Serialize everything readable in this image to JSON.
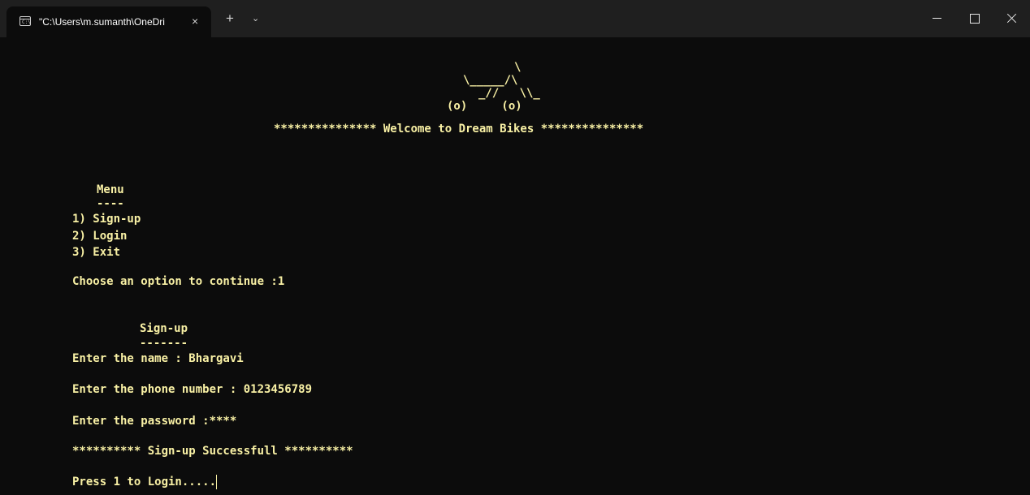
{
  "window": {
    "tab_title": "\"C:\\Users\\m.sumanth\\OneDri",
    "tab_icon_text": "C:\\",
    "tab_close": "×",
    "new_tab": "+",
    "dropdown": "⌄",
    "icons": {
      "tab": "terminal-icon",
      "minimize": "minimize-icon",
      "maximize": "maximize-icon",
      "close": "close-icon"
    }
  },
  "terminal": {
    "colors": {
      "background": "#0c0c0c",
      "text": "#f9f1a5"
    },
    "art": {
      "line1": "\\",
      "line2": "\\_____/\\",
      "line3": "_//   \\\\_",
      "line4": "(o)     (o)"
    },
    "welcome": "*************** Welcome to Dream Bikes ***************",
    "menu": {
      "title": "Menu",
      "underline": "----",
      "options": [
        "1) Sign-up",
        "2) Login",
        "3) Exit"
      ]
    },
    "choose_prompt": "Choose an option to continue :1",
    "signup": {
      "title": "Sign-up",
      "underline": "-------",
      "name_prompt": "Enter the name : Bhargavi",
      "phone_prompt": "Enter the phone number : 0123456789",
      "password_prompt": "Enter the password :****",
      "success": "********** Sign-up Successfull **********",
      "continue": "Press 1 to Login....."
    }
  }
}
